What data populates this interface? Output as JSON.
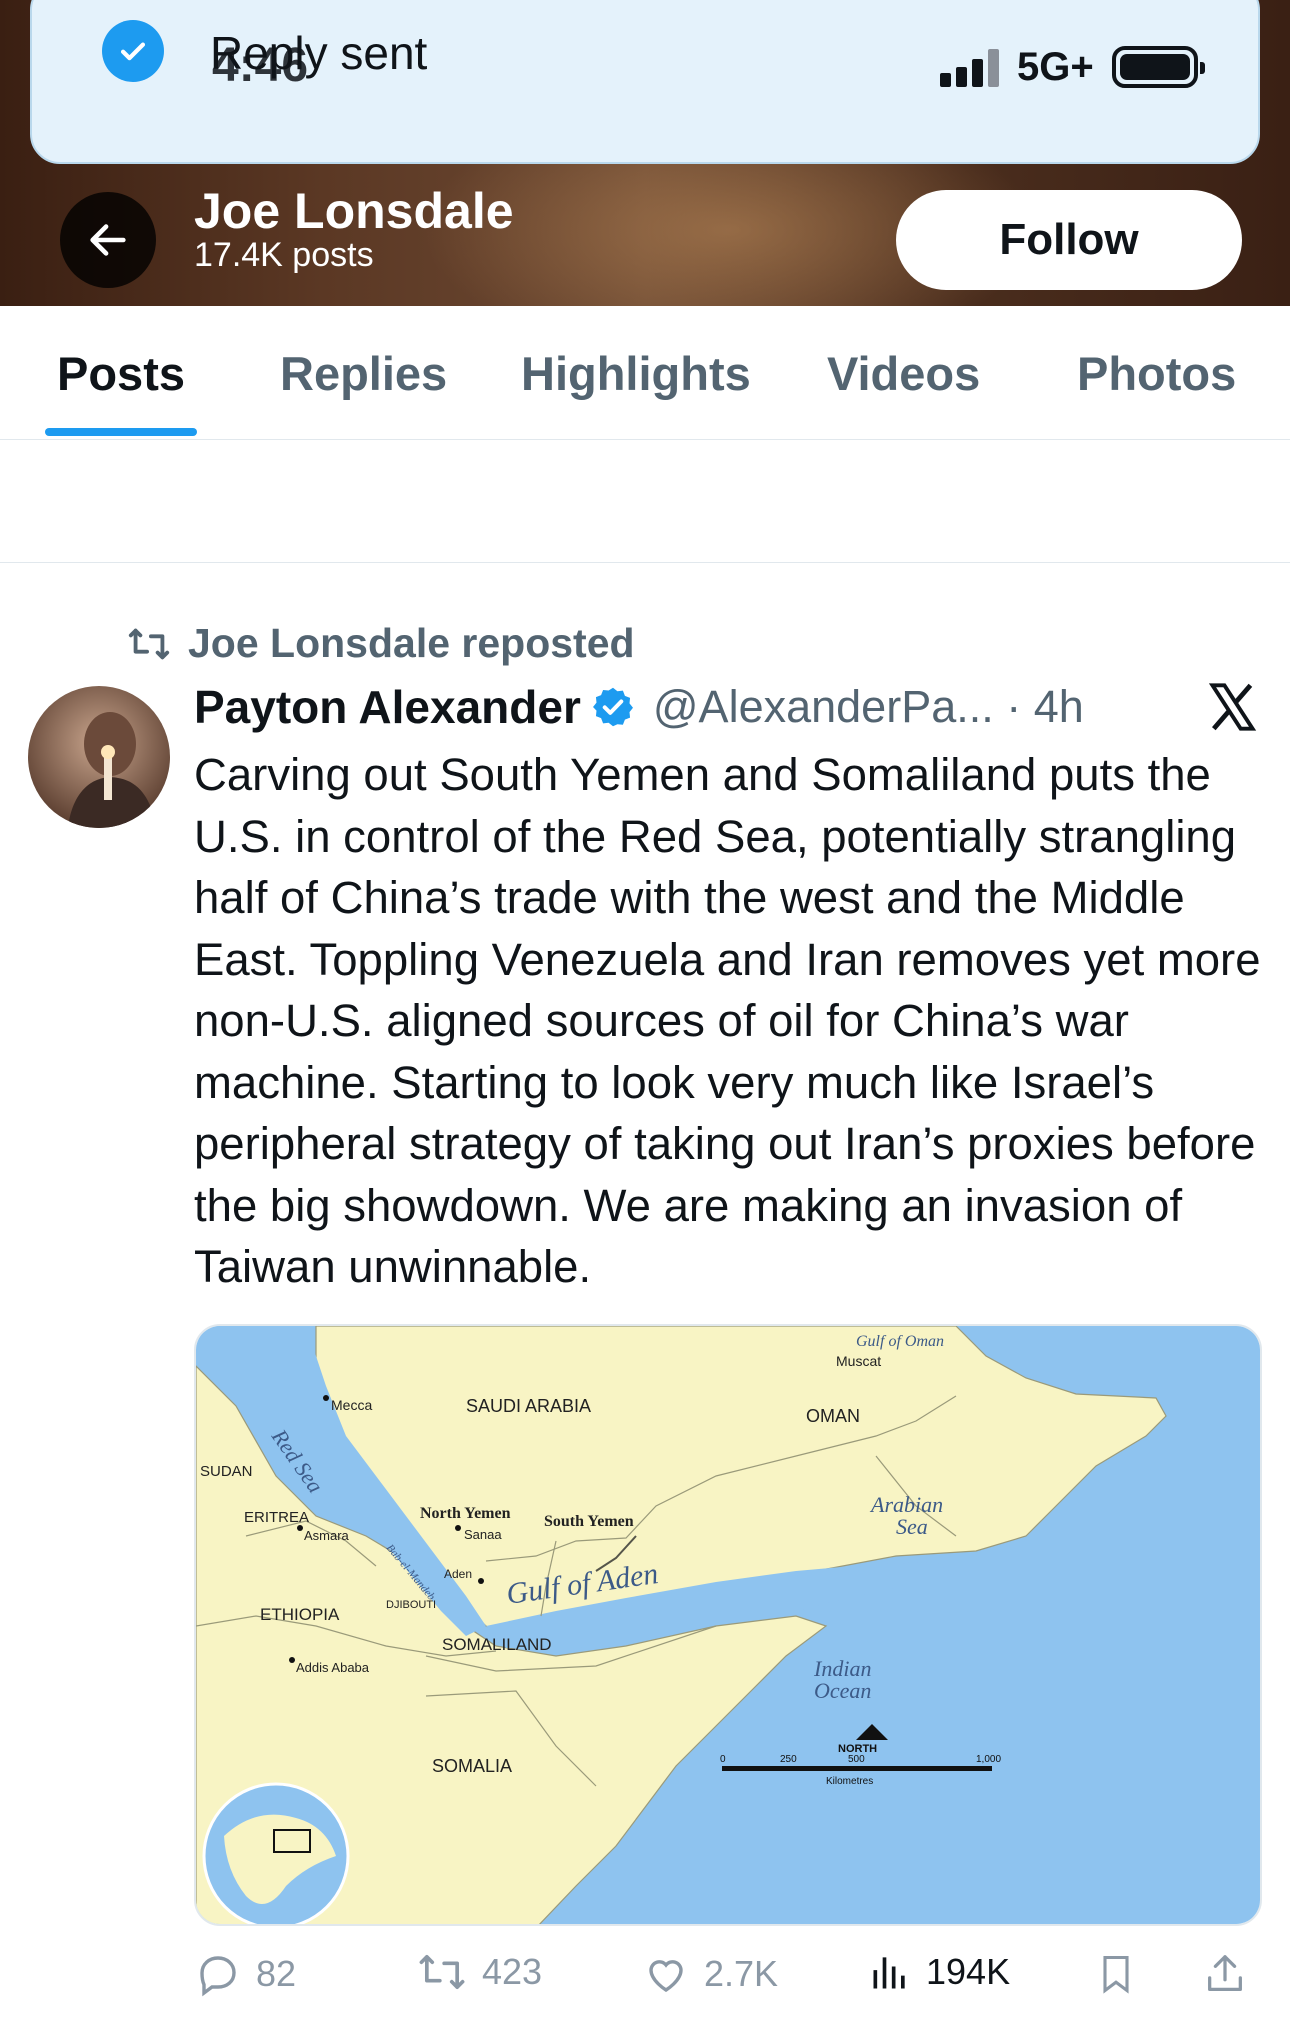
{
  "toast": {
    "message": "Reply sent"
  },
  "status_bar": {
    "time": "4:46",
    "network": "5G+"
  },
  "profile": {
    "name": "Joe Lonsdale",
    "posts_count": "17.4K posts",
    "follow_label": "Follow"
  },
  "tabs": [
    {
      "label": "Posts",
      "active": true
    },
    {
      "label": "Replies"
    },
    {
      "label": "Highlights"
    },
    {
      "label": "Videos"
    },
    {
      "label": "Photos"
    }
  ],
  "post": {
    "repost_label": "Joe Lonsdale reposted",
    "author_name": "Payton Alexander",
    "author_handle_time": "@AlexanderPa... · 4h",
    "text": "Carving out South Yemen and Somaliland puts the U.S. in control of the Red Sea, potentially strangling half of China’s trade with the west and the Middle East. Toppling Venezuela and Iran removes yet more non-U.S. aligned sources of oil for China’s war machine. Starting to look very much like Israel’s peripheral strategy of taking out Iran’s proxies before the big showdown. We are making an invasion of Taiwan unwinnable.",
    "map": {
      "labels": {
        "gulf_of_oman": "Gulf of Oman",
        "muscat": "Muscat",
        "mecca": "Mecca",
        "saudi_arabia": "SAUDI ARABIA",
        "oman": "OMAN",
        "red_sea": "Red Sea",
        "sudan": "SUDAN",
        "arabian_sea_1": "Arabian",
        "arabian_sea_2": "Sea",
        "eritrea": "ERITREA",
        "asmara": "Asmara",
        "north_yemen": "North Yemen",
        "sanaa": "Sanaa",
        "south_yemen": "South Yemen",
        "bab_el_mandeb": "Bab-el-Mandeb",
        "aden": "Aden",
        "djibouti": "DJIBOUTI",
        "gulf_of_aden": "Gulf of Aden",
        "ethiopia": "ETHIOPIA",
        "somaliland": "SOMALILAND",
        "addis_ababa": "Addis Ababa",
        "indian_ocean_1": "Indian",
        "indian_ocean_2": "Ocean",
        "north": "NORTH",
        "somalia": "SOMALIA",
        "scale_0": "0",
        "scale_250": "250",
        "scale_500": "500",
        "scale_1000": "1,000",
        "kilometres": "Kilometres"
      }
    },
    "stats": {
      "replies": "82",
      "reposts": "423",
      "likes": "2.7K",
      "views": "194K"
    }
  },
  "colors": {
    "accent": "#1d9bf0",
    "land": "#f8f4c4",
    "sea": "#8ec3ef"
  }
}
